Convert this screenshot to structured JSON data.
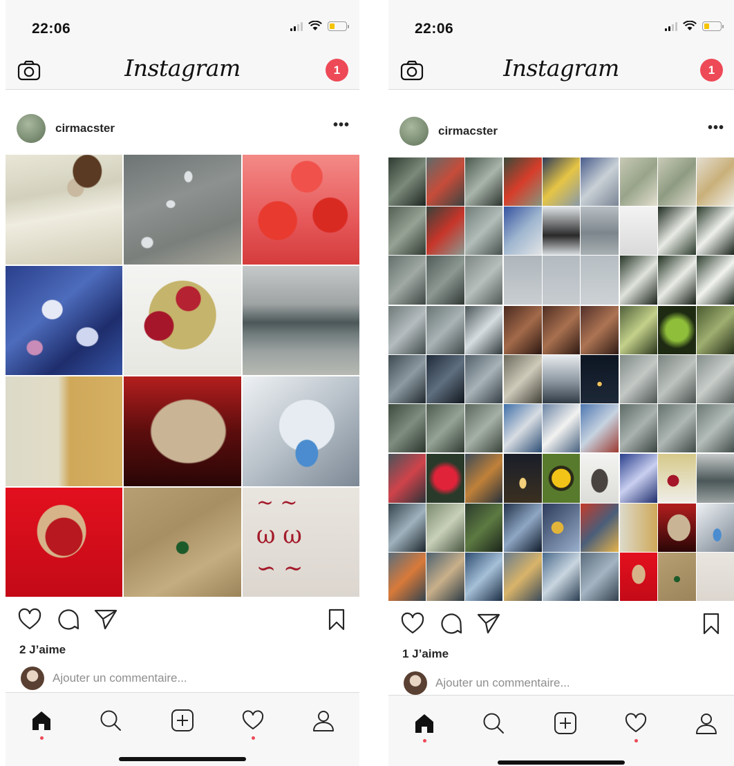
{
  "screens": [
    {
      "status": {
        "time": "22:06"
      },
      "header": {
        "logo": "Instagram",
        "notification_count": "1"
      },
      "partial_top_text": "",
      "post": {
        "username": "cirmacster",
        "more_label": "•••",
        "likes": "2 J’aime",
        "comment_placeholder": "Ajouter un commentaire..."
      }
    },
    {
      "status": {
        "time": "22:06"
      },
      "header": {
        "logo": "Instagram",
        "notification_count": "1"
      },
      "partial_top_text": "",
      "post": {
        "username": "cirmacster",
        "more_label": "•••",
        "likes": "1 J’aime",
        "comment_placeholder": "Ajouter un commentaire..."
      }
    }
  ],
  "icons": {
    "header_left": "camera-icon",
    "actions": [
      "heart-icon",
      "comment-icon",
      "share-icon",
      "bookmark-icon"
    ],
    "tabs": [
      "home-icon",
      "search-icon",
      "add-post-icon",
      "activity-heart-icon",
      "profile-icon"
    ]
  },
  "colors": {
    "badge": "#ed4956",
    "bar_background": "#f7f7f7",
    "text": "#262626",
    "muted_text": "#8e8e8e"
  }
}
